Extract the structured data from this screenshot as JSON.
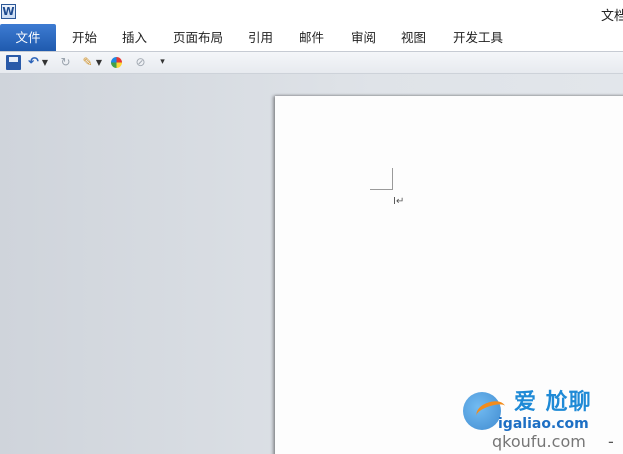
{
  "window": {
    "app_icon": "word-icon",
    "app_icon_letter": "W",
    "title": "文档"
  },
  "ribbon": {
    "tabs": [
      {
        "label": "文件",
        "active": true
      },
      {
        "label": "开始"
      },
      {
        "label": "插入"
      },
      {
        "label": "页面布局"
      },
      {
        "label": "引用"
      },
      {
        "label": "邮件"
      },
      {
        "label": "审阅"
      },
      {
        "label": "视图"
      },
      {
        "label": "开发工具"
      }
    ],
    "file_tab_color": "#2b68be"
  },
  "quick_access": {
    "buttons": [
      {
        "icon": "save-icon"
      },
      {
        "icon": "undo-icon"
      },
      {
        "icon": "undo-dropdown-icon"
      },
      {
        "icon": "redo-icon"
      },
      {
        "icon": "format-painter-icon"
      },
      {
        "icon": "format-dropdown-icon"
      },
      {
        "icon": "color-wheel-icon"
      },
      {
        "icon": "strikethrough-icon"
      },
      {
        "icon": "customize-toolbar-icon"
      }
    ]
  },
  "document": {
    "paragraph_mark": "↵"
  },
  "watermark": {
    "brand": "爱 尬聊",
    "site": "igaliao.com",
    "sub": "qkoufu.com",
    "dash": "-"
  }
}
